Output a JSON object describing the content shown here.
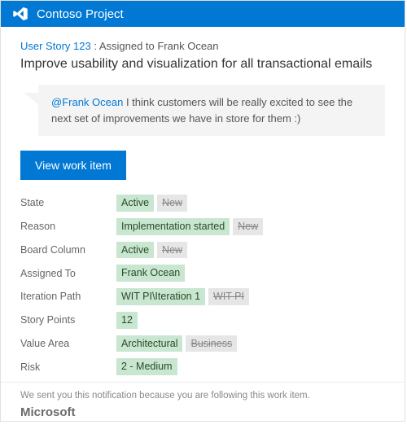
{
  "header": {
    "project_name": "Contoso Project"
  },
  "crumb": {
    "link_text": "User Story 123",
    "suffix": " : Assigned to Frank Ocean"
  },
  "title": "Improve usability and visualization for all transactional emails",
  "comment": {
    "mention": "@Frank Ocean",
    "text": " I think customers will be really excited to see the next set of improvements we have in store for them :)"
  },
  "cta_label": "View work item",
  "fields": [
    {
      "label": "State",
      "current": "Active",
      "prev": "New"
    },
    {
      "label": "Reason",
      "current": "Implementation started",
      "prev": "New"
    },
    {
      "label": "Board Column",
      "current": "Active",
      "prev": "New"
    },
    {
      "label": "Assigned To",
      "current": "Frank Ocean",
      "prev": null
    },
    {
      "label": "Iteration Path",
      "current": "WIT PI\\Iteration 1",
      "prev": "WIT PI"
    },
    {
      "label": "Story Points",
      "current": "12",
      "prev": null
    },
    {
      "label": "Value Area",
      "current": "Architectural",
      "prev": "Business"
    },
    {
      "label": "Risk",
      "current": "2 - Medium",
      "prev": null
    }
  ],
  "footer": {
    "reason": "We sent you this notification because you are following this work item.",
    "brand": "Microsoft"
  },
  "colors": {
    "accent": "#0078d4"
  }
}
